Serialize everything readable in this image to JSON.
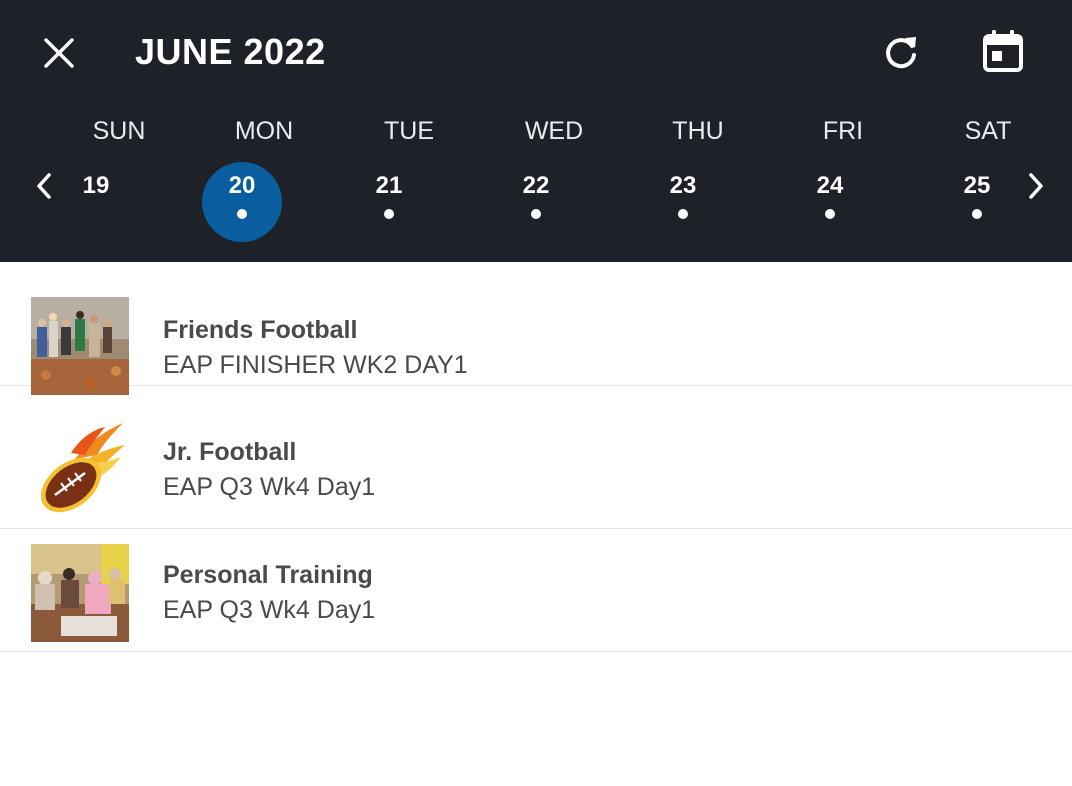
{
  "header": {
    "title": "JUNE 2022",
    "close_icon": "close-icon",
    "refresh_icon": "refresh-icon",
    "calendar_icon": "calendar-icon",
    "background": "#1e2127"
  },
  "week": {
    "days_of_week": [
      "SUN",
      "MON",
      "TUE",
      "WED",
      "THU",
      "FRI",
      "SAT"
    ],
    "dates": [
      {
        "num": "19",
        "selected": false,
        "has_event": false
      },
      {
        "num": "20",
        "selected": true,
        "has_event": true
      },
      {
        "num": "21",
        "selected": false,
        "has_event": true
      },
      {
        "num": "22",
        "selected": false,
        "has_event": true
      },
      {
        "num": "23",
        "selected": false,
        "has_event": true
      },
      {
        "num": "24",
        "selected": false,
        "has_event": true
      },
      {
        "num": "25",
        "selected": false,
        "has_event": true
      }
    ],
    "prev_icon": "chevron-left-icon",
    "next_icon": "chevron-right-icon",
    "selected_color": "#0a5d9e"
  },
  "programs": [
    {
      "title": "Friends Football",
      "subtitle": "EAP FINISHER WK2 DAY1",
      "thumb": "group-photo"
    },
    {
      "title": "Jr. Football",
      "subtitle": "EAP Q3 Wk4 Day1",
      "thumb": "flaming-football-icon"
    },
    {
      "title": "Personal Training",
      "subtitle": "EAP Q3 Wk4 Day1",
      "thumb": "group-photo"
    }
  ]
}
